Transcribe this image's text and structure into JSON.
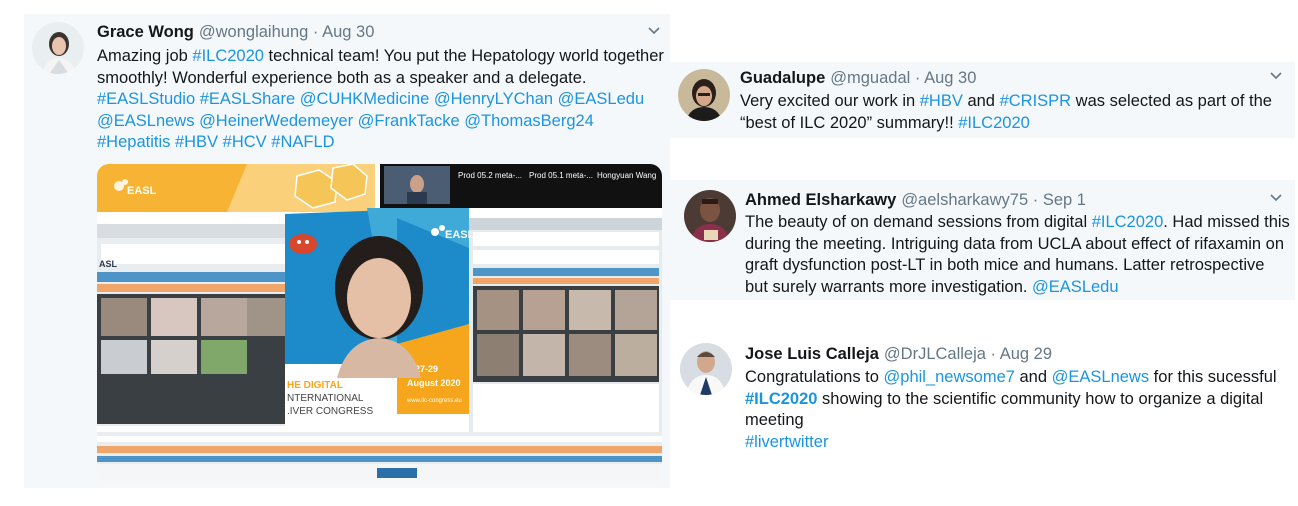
{
  "tweets": [
    {
      "name": "Grace Wong",
      "handle": "@wonglaihung",
      "sep": "·",
      "date": "Aug 30",
      "text": {
        "p1": "Amazing job ",
        "t1": "#ILC2020",
        "p2": " technical team! You put the Hepatology world together smoothly! Wonderful experience both as a speaker and a delegate. ",
        "links": [
          "#EASLStudio",
          "#EASLShare",
          "@CUHKMedicine",
          "@HenryLYChan",
          "@EASLedu",
          "@EASLnews",
          "@HeinerWedemeyer",
          "@FrankTacke",
          "@ThomasBerg24",
          "#Hepatitis",
          "#HBV",
          "#HCV",
          "#NAFLD"
        ]
      },
      "media": {
        "easl_logo": "EASL",
        "participants": [
          "Prod 05.2 meta-...",
          "Prod 05.1 meta-...",
          "Hongyuan Wang"
        ],
        "event_line1": "HE DIGITAL",
        "event_line2": "NTERNATIONAL",
        "event_line3": ".IVER CONGRESS",
        "dates": "27-29",
        "month": "August 2020",
        "url": "www.ilc-congress.eu",
        "screen_label": "ASL"
      }
    },
    {
      "name": "Guadalupe",
      "handle": "@mguadal",
      "sep": "·",
      "date": "Aug 30",
      "text": {
        "p1": "Very excited our work in ",
        "t1": "#HBV",
        "p2": " and ",
        "t2": "#CRISPR",
        "p3": " was selected as part of the “best of ILC 2020” summary!! ",
        "t3": "#ILC2020"
      }
    },
    {
      "name": "Ahmed Elsharkawy",
      "handle": "@aelsharkawy75",
      "sep": "·",
      "date": "Sep 1",
      "text": {
        "p1": "The beauty of on demand sessions from digital ",
        "t1": "#ILC2020",
        "p2": ". Had missed this during the meeting. Intriguing data from UCLA about effect of rifaxamin on graft dysfunction post-LT in both mice and humans. Latter retrospective but surely warrants more investigation. ",
        "t2": "@EASLedu"
      }
    },
    {
      "name": "Jose Luis Calleja",
      "handle": "@DrJLCalleja",
      "sep": "·",
      "date": "Aug 29",
      "text": {
        "p1": "Congratulations to ",
        "t1": "@phil_newsome7",
        "p2": " and ",
        "t2": "@EASLnews",
        "p3": " for this sucessful ",
        "t3": "#ILC2020",
        "p4": " showing to the scientific community how to organize a digital meeting",
        "t4": "#livertwitter"
      }
    }
  ],
  "icons": {
    "chevron": "chevron-down-icon",
    "avatar": "avatar"
  },
  "colors": {
    "link": "#1b95e0",
    "text": "#14171a",
    "muted": "#657786",
    "card_bg": "#f5f8fa",
    "easl_orange": "#f6a61d",
    "easl_blue": "#009bc9"
  }
}
